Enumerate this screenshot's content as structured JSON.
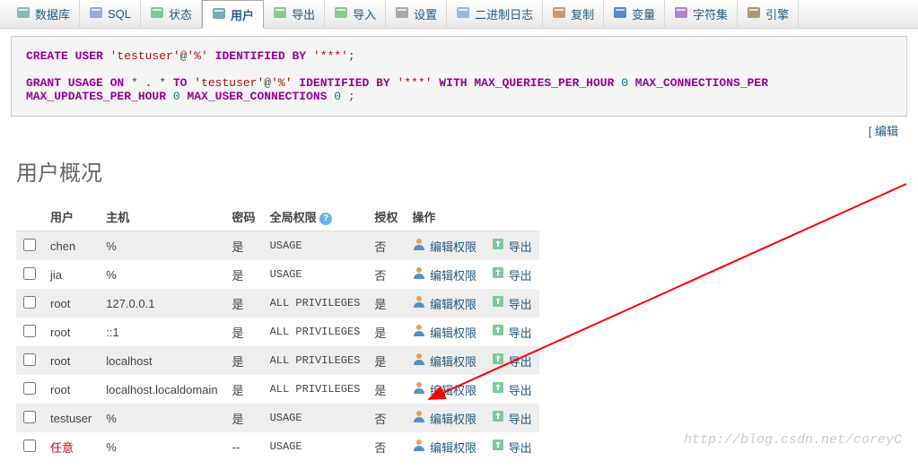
{
  "tabs": [
    {
      "label": "数据库",
      "icon": "db"
    },
    {
      "label": "SQL",
      "icon": "sql"
    },
    {
      "label": "状态",
      "icon": "status"
    },
    {
      "label": "用户",
      "icon": "users",
      "active": true
    },
    {
      "label": "导出",
      "icon": "export"
    },
    {
      "label": "导入",
      "icon": "import"
    },
    {
      "label": "设置",
      "icon": "settings"
    },
    {
      "label": "二进制日志",
      "icon": "binlog"
    },
    {
      "label": "复制",
      "icon": "replication"
    },
    {
      "label": "变量",
      "icon": "vars"
    },
    {
      "label": "字符集",
      "icon": "charset"
    },
    {
      "label": "引擎",
      "icon": "engine"
    }
  ],
  "sql": {
    "line1_pre": "CREATE ",
    "line1_kw": "USER ",
    "line1_str1": "'testuser'",
    "line1_at": "@",
    "line1_str2": "'%'",
    "line1_kw2": " IDENTIFIED BY ",
    "line1_str3": "'***'",
    "line1_end": ";",
    "line2_kw1": "GRANT USAGE ON ",
    "line2_star": "* . *",
    "line2_kw2": " TO ",
    "line2_str1": "'testuser'",
    "line2_at": "@",
    "line2_str2": "'%'",
    "line2_kw3": " IDENTIFIED BY ",
    "line2_str3": "'***'",
    "line2_kw4": " WITH MAX_QUERIES_PER_HOUR ",
    "line2_n1": "0",
    "line2_kw5": " MAX_CONNECTIONS_PER",
    "line2_cont": "MAX_UPDATES_PER_HOUR ",
    "line2_n2": "0",
    "line2_kw6": " MAX_USER_CONNECTIONS ",
    "line2_n3": "0",
    "line2_end": " ;"
  },
  "edit_link": "[ 编辑",
  "heading": "用户概况",
  "columns": {
    "c0": "",
    "c1": "用户",
    "c2": "主机",
    "c3": "密码",
    "c4": "全局权限",
    "c5": "授权",
    "c6": "操作"
  },
  "action": {
    "edit": "编辑权限",
    "export": "导出"
  },
  "rows": [
    {
      "user": "chen",
      "host": "%",
      "pwd": "是",
      "priv": "USAGE",
      "grant": "否"
    },
    {
      "user": "jia",
      "host": "%",
      "pwd": "是",
      "priv": "USAGE",
      "grant": "否"
    },
    {
      "user": "root",
      "host": "127.0.0.1",
      "pwd": "是",
      "priv": "ALL PRIVILEGES",
      "grant": "是"
    },
    {
      "user": "root",
      "host": "::1",
      "pwd": "是",
      "priv": "ALL PRIVILEGES",
      "grant": "是"
    },
    {
      "user": "root",
      "host": "localhost",
      "pwd": "是",
      "priv": "ALL PRIVILEGES",
      "grant": "是"
    },
    {
      "user": "root",
      "host": "localhost.localdomain",
      "pwd": "是",
      "priv": "ALL PRIVILEGES",
      "grant": "是"
    },
    {
      "user": "testuser",
      "host": "%",
      "pwd": "是",
      "priv": "USAGE",
      "grant": "否"
    },
    {
      "user": "任意",
      "host": "%",
      "pwd": "--",
      "priv": "USAGE",
      "grant": "否",
      "red": true
    }
  ],
  "watermark": "http://blog.csdn.net/coreyC"
}
